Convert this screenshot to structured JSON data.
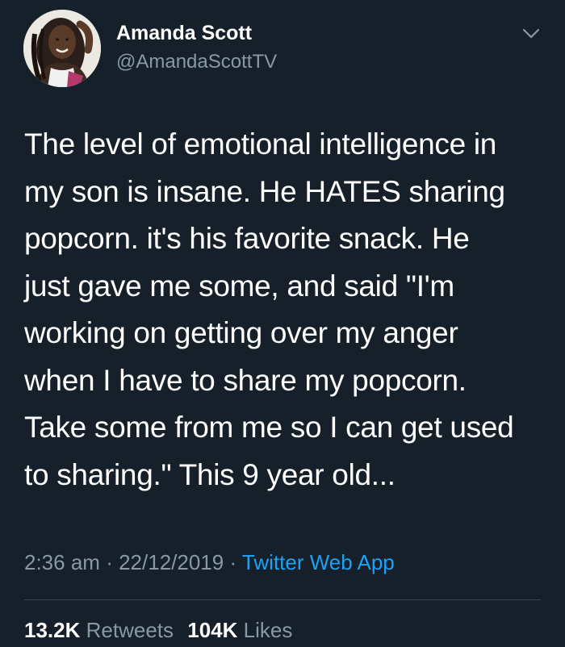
{
  "author": {
    "name": "Amanda Scott",
    "handle": "@AmandaScottTV",
    "avatar_icon": "profile-photo"
  },
  "tweet": {
    "lines": [
      "The level of emotional intelligence in",
      "my son is insane. He HATES sharing",
      "popcorn. it's his favorite snack. He",
      "just gave me some, and said \"I'm",
      "working on getting over my anger",
      "when I have to share my popcorn.",
      "Take some from me so I can get used",
      "to sharing.\" This 9 year old..."
    ]
  },
  "meta": {
    "time": "2:36 am",
    "separator": "·",
    "date": "22/12/2019",
    "source": "Twitter Web App"
  },
  "stats": {
    "retweets_count": "13.2K",
    "retweets_label": "Retweets",
    "likes_count": "104K",
    "likes_label": "Likes"
  },
  "colors": {
    "background": "#15202b",
    "text": "#ffffff",
    "secondary": "#8899a6",
    "link": "#1da1f2",
    "divider": "#38444d"
  }
}
